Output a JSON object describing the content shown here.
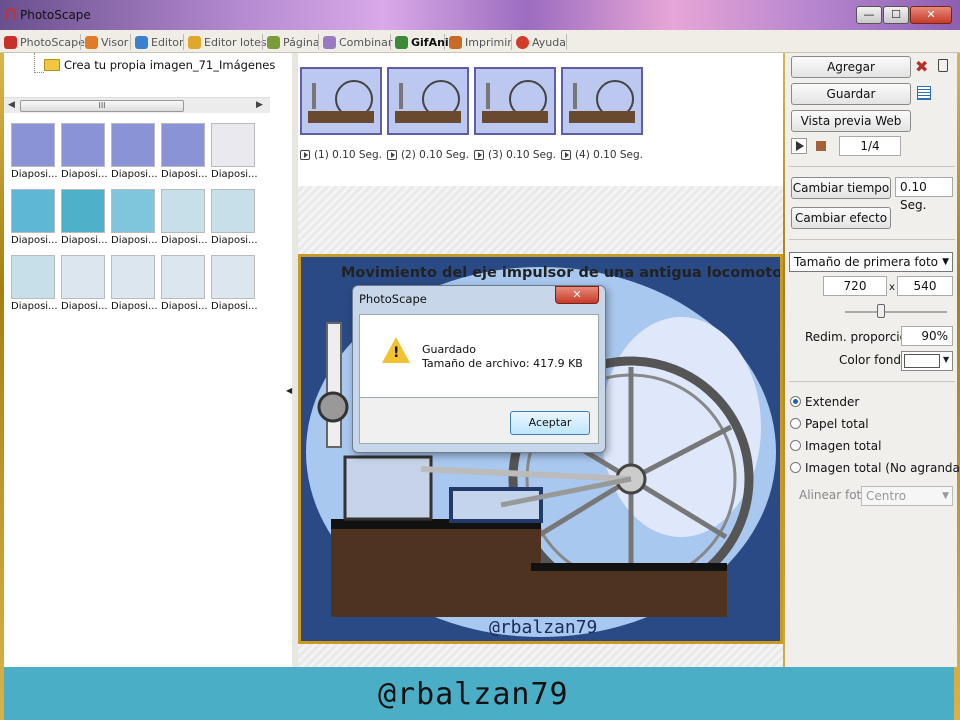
{
  "window": {
    "title": "PhotoScape",
    "controls": {
      "minimize": "—",
      "maximize": "☐",
      "close": "✕"
    }
  },
  "tabs": [
    {
      "label": "PhotoScape",
      "icon": "photoscape-icon",
      "color": "#c9302c"
    },
    {
      "label": "Visor",
      "icon": "viewer-icon",
      "color": "#e07b2a"
    },
    {
      "label": "Editor",
      "icon": "editor-icon",
      "color": "#3b7fcf"
    },
    {
      "label": "Editor lotes",
      "icon": "batch-editor-icon",
      "color": "#e0a82a"
    },
    {
      "label": "Página",
      "icon": "page-icon",
      "color": "#7a9b3a"
    },
    {
      "label": "Combinar",
      "icon": "combine-icon",
      "color": "#9a7bc2"
    },
    {
      "label": "GifAni",
      "icon": "gif-animation-icon",
      "color": "#3a8a3a",
      "active": true
    },
    {
      "label": "Imprimir",
      "icon": "print-icon",
      "color": "#c86a2a"
    },
    {
      "label": "Ayuda",
      "icon": "help-icon",
      "color": "#d23a2a"
    }
  ],
  "left_panel": {
    "folder_name": "Crea tu propia imagen_71_Imágenes",
    "scroll_grip": "III",
    "thumbnails": [
      {
        "caption": "Diaposi...",
        "color": "#8a93d6"
      },
      {
        "caption": "Diaposi...",
        "color": "#8a93d6"
      },
      {
        "caption": "Diaposi...",
        "color": "#8a93d6"
      },
      {
        "caption": "Diaposi...",
        "color": "#8a93d6"
      },
      {
        "caption": "Diaposi...",
        "color": "#e9e9ef"
      },
      {
        "caption": "Diaposi...",
        "color": "#5fb7d6"
      },
      {
        "caption": "Diaposi...",
        "color": "#4fb0c9"
      },
      {
        "caption": "Diaposi...",
        "color": "#7fc6dc"
      },
      {
        "caption": "Diaposi...",
        "color": "#c6dfe8"
      },
      {
        "caption": "Diaposi...",
        "color": "#c6dfe8"
      },
      {
        "caption": "Diaposi...",
        "color": "#c6dfe8"
      },
      {
        "caption": "Diaposi...",
        "color": "#dbe6ee"
      },
      {
        "caption": "Diaposi...",
        "color": "#dbe6ee"
      },
      {
        "caption": "Diaposi...",
        "color": "#dbe6ee"
      },
      {
        "caption": "Diaposi...",
        "color": "#dbe6ee"
      }
    ]
  },
  "frames": [
    {
      "label": "(1) 0.10 Seg."
    },
    {
      "label": "(2) 0.10 Seg."
    },
    {
      "label": "(3) 0.10 Seg."
    },
    {
      "label": "(4) 0.10 Seg."
    }
  ],
  "preview": {
    "title": "Movimiento del eje impulsor de una antigua locomotora",
    "watermark": "@rbalzan79"
  },
  "dialog": {
    "title": "PhotoScape",
    "close": "✕",
    "line1": "Guardado",
    "line2": "Tamaño de archivo: 417.9 KB",
    "ok": "Aceptar"
  },
  "right_panel": {
    "add": "Agregar",
    "save": "Guardar",
    "web_preview": "Vista previa Web",
    "frame_counter": "1/4",
    "change_time": "Cambiar tiempo",
    "time_value": "0.10 Seg.",
    "change_effect": "Cambiar efecto",
    "size_select": "Tamaño de primera foto",
    "width": "720",
    "x": "x",
    "height": "540",
    "resize_label": "Redim. proporción",
    "resize_value": "90%",
    "bg_color_label": "Color fondo",
    "bg_color": "#ffffff",
    "options": [
      {
        "label": "Extender",
        "checked": true
      },
      {
        "label": "Papel total",
        "checked": false
      },
      {
        "label": "Imagen total",
        "checked": false
      },
      {
        "label": "Imagen total (No agrandada)",
        "checked": false
      }
    ],
    "align_label": "Alinear foto",
    "align_value": "Centro"
  },
  "banner": {
    "text": "@rbalzan79",
    "color": "#4aaec6"
  }
}
